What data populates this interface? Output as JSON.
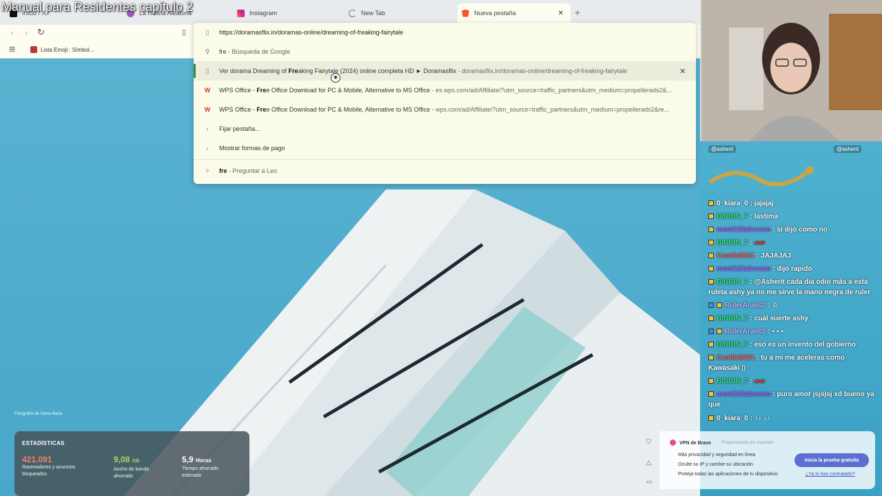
{
  "overlay": {
    "title": "Manual para Residentes capítulo 2"
  },
  "tabs": [
    {
      "label": "Inicio / X",
      "color": "#111111"
    },
    {
      "label": "La Ruleta Aleatoria",
      "color": "#9b59b6"
    },
    {
      "label": "Instagram",
      "color": "#d62976"
    },
    {
      "label": "New Tab",
      "color": "#888888"
    },
    {
      "label": "Nueva pestaña",
      "color": "#fb542b"
    }
  ],
  "bookmarks": {
    "item_label": "Lista Emoji : Símbol..."
  },
  "omnibox": {
    "value": "https://doramasflix.in/doramas-online/dreaming-of-freaking-fairytale",
    "search_row": {
      "query": "fre",
      "suffix": "- Búsqueda de Google"
    },
    "suggestion_1": {
      "pre": "Ver dorama Dreaming of ",
      "bold": "Fre",
      "post": "aking Fairytale (2024) online completa HD ► Doramasflix",
      "url": "- doramasflix.in/doramas-online/dreaming-of-freaking-fairytale"
    },
    "suggestion_2": {
      "pre": "WPS Office - ",
      "bold": "Fre",
      "post": "e Office Download for PC & Mobile, Alternative to MS Office",
      "url": "- es.wps.com/ad/Affiliate/?utm_source=traffic_partners&utm_medium=propellerads2&..."
    },
    "suggestion_3": {
      "pre": "WPS Office - ",
      "bold": "Fre",
      "post": "e Office Download for PC & Mobile, Alternative to MS Office",
      "url": "- wps.com/ad/Affiliate/?utm_source=traffic_partners&utm_medium=propellerads2&re..."
    },
    "action_1": "Fijar pestaña...",
    "action_2": "Mostrar formas de pago",
    "leo": {
      "query": "fre",
      "suffix": "- Preguntar a Leo"
    }
  },
  "wallpaper": {
    "credit": "Fotografía de Sama Barta"
  },
  "stats": {
    "title": "ESTADÍSTICAS",
    "trackers": {
      "value": "421.091",
      "label1": "Rastreadores y anuncios",
      "label2": "bloqueados",
      "color": "#ff7b63"
    },
    "bandwidth": {
      "value": "9,08",
      "unit": "GB",
      "label1": "Ancho de banda",
      "label2": "ahorrado",
      "color": "#a4d66b"
    },
    "time": {
      "value": "5,9",
      "unit": "Horas",
      "label1": "Tiempo ahorrado",
      "label2": "estimado",
      "color": "#ffffff"
    }
  },
  "vpn": {
    "title": "VPN de Brave",
    "sponsor": "Proporcionado por Guardian",
    "line1": "Más privacidad y seguridad en línea",
    "line2": "Oculte su IP y cambie su ubicación",
    "line3": "Proteja todas las aplicaciones de tu dispositivo",
    "button": "Inicia la prueba gratuita",
    "link": "¿Ya lo has contratado?"
  },
  "stream": {
    "handle_left": "@asherit",
    "handle_right": "@asherit"
  },
  "chat": [
    {
      "user": "0_kiara_0",
      "color": "#ffffff",
      "msg": "jajajaj"
    },
    {
      "user": "BINBIN_7",
      "color": "#36e07a",
      "msg": "lastima"
    },
    {
      "user": "moni123abvcnm",
      "color": "#b05cff",
      "msg": "si dijo como no"
    },
    {
      "user": "BINBIN_7",
      "color": "#36e07a",
      "msg": "▰▰"
    },
    {
      "user": "Camila5921",
      "color": "#ff5e5e",
      "msg": "JAJAJAJ"
    },
    {
      "user": "moni123abvcnm",
      "color": "#b05cff",
      "msg": "dijo rapido"
    },
    {
      "user": "BINBIN_7",
      "color": "#36e07a",
      "msg": "@Asherit cada día odio más a esta ruleta ashy ya no me sirve la mano negra de ruler"
    },
    {
      "user": "RulerAran02",
      "color": "#c9b7ff",
      "msg": "♘"
    },
    {
      "user": "BINBIN_7",
      "color": "#36e07a",
      "msg": "cuál suerte ashy"
    },
    {
      "user": "RulerAran02",
      "color": "#c9b7ff",
      "msg": "▪ ▪ ▪"
    },
    {
      "user": "BINBIN_7",
      "color": "#36e07a",
      "msg": "eso es un invento del gobierno"
    },
    {
      "user": "Camila5921",
      "color": "#ff5e5e",
      "msg": "tu a mi me aceleras como Kawasaki ▯"
    },
    {
      "user": "BINBIN_7",
      "color": "#36e07a",
      "msg": "▰▰"
    },
    {
      "user": "moni123abvcnm",
      "color": "#b05cff",
      "msg": "puro amor jsjsjsj xd bueno ya que"
    },
    {
      "user": "0_kiara_0",
      "color": "#ffffff",
      "msg": "♪♪ ♪♪"
    }
  ]
}
